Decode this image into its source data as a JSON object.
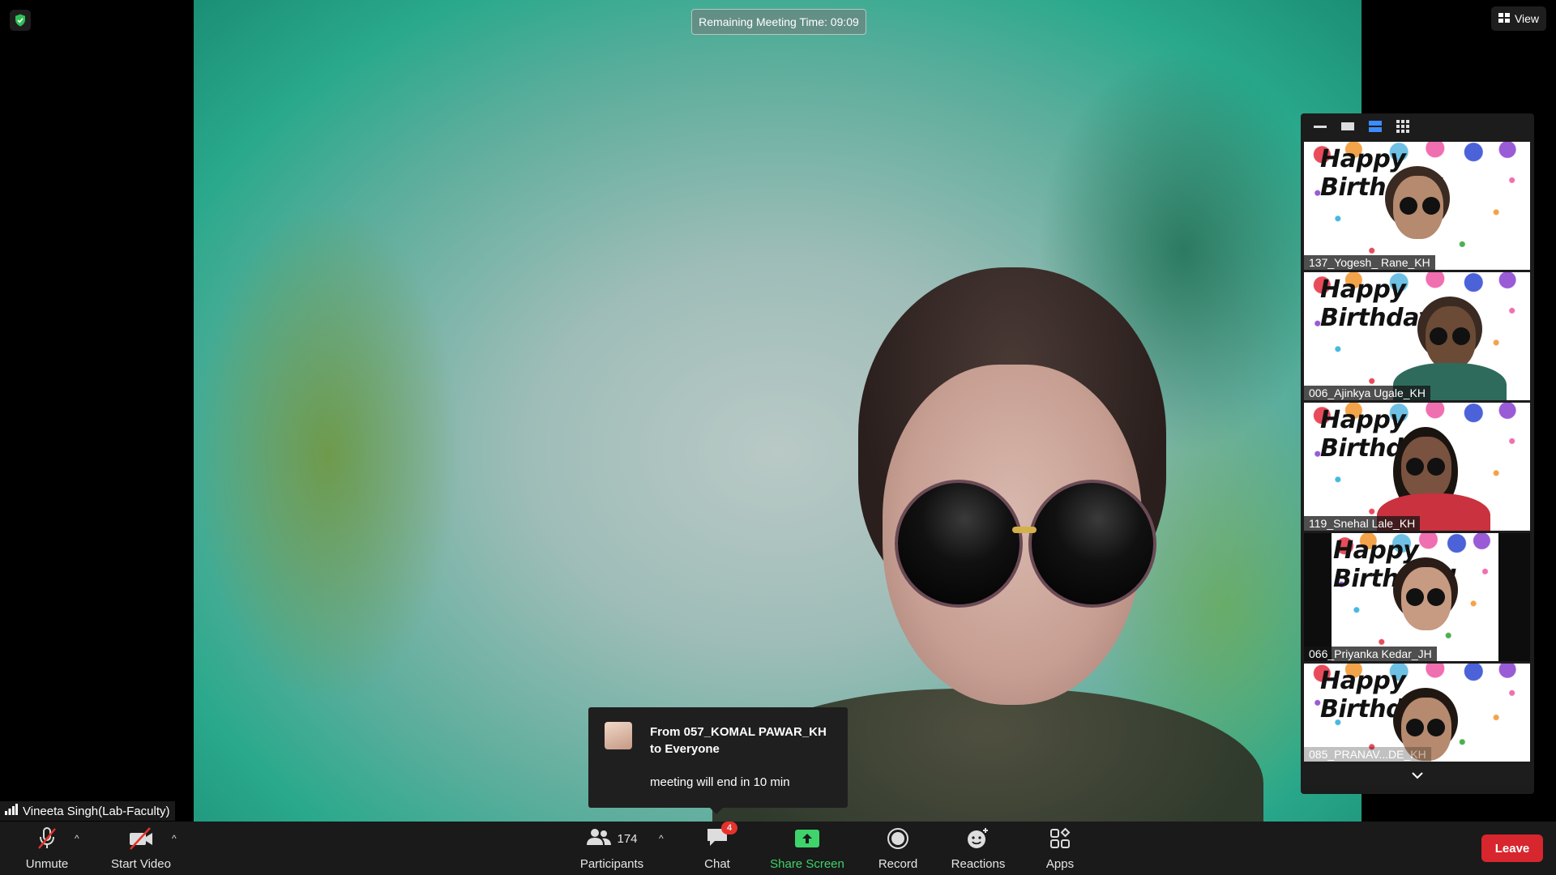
{
  "meeting": {
    "timer_label": "Remaining Meeting Time: 09:09",
    "view_label": "View",
    "speaker_name": "Vineeta Singh(Lab-Faculty)"
  },
  "gallery": {
    "tiles": [
      {
        "name": "137_Yogesh_ Rane_KH",
        "banner": "Happy Birthday!"
      },
      {
        "name": "006_Ajinkya Ugale_KH",
        "banner": "Happy Birthday!"
      },
      {
        "name": "119_Snehal Lale_KH",
        "banner": "Happy Birthday!"
      },
      {
        "name": "066_Priyanka Kedar_JH",
        "banner": "Happy Birthday!"
      },
      {
        "name": "085_PRANAV...DE_KH",
        "banner": "Happy Birthday!"
      }
    ]
  },
  "chat_toast": {
    "title": "From 057_KOMAL PAWAR_KH to Everyone",
    "message": "meeting will end in 10 min"
  },
  "toolbar": {
    "unmute": "Unmute",
    "start_video": "Start Video",
    "participants": "Participants",
    "participant_count": "174",
    "chat": "Chat",
    "chat_badge": "4",
    "share_screen": "Share Screen",
    "record": "Record",
    "reactions": "Reactions",
    "apps": "Apps",
    "leave": "Leave"
  },
  "colors": {
    "accent_green": "#3ed36b",
    "leave_red": "#d7262e",
    "badge_red": "#e5322b",
    "toolbar_bg": "#1a1a1a"
  }
}
